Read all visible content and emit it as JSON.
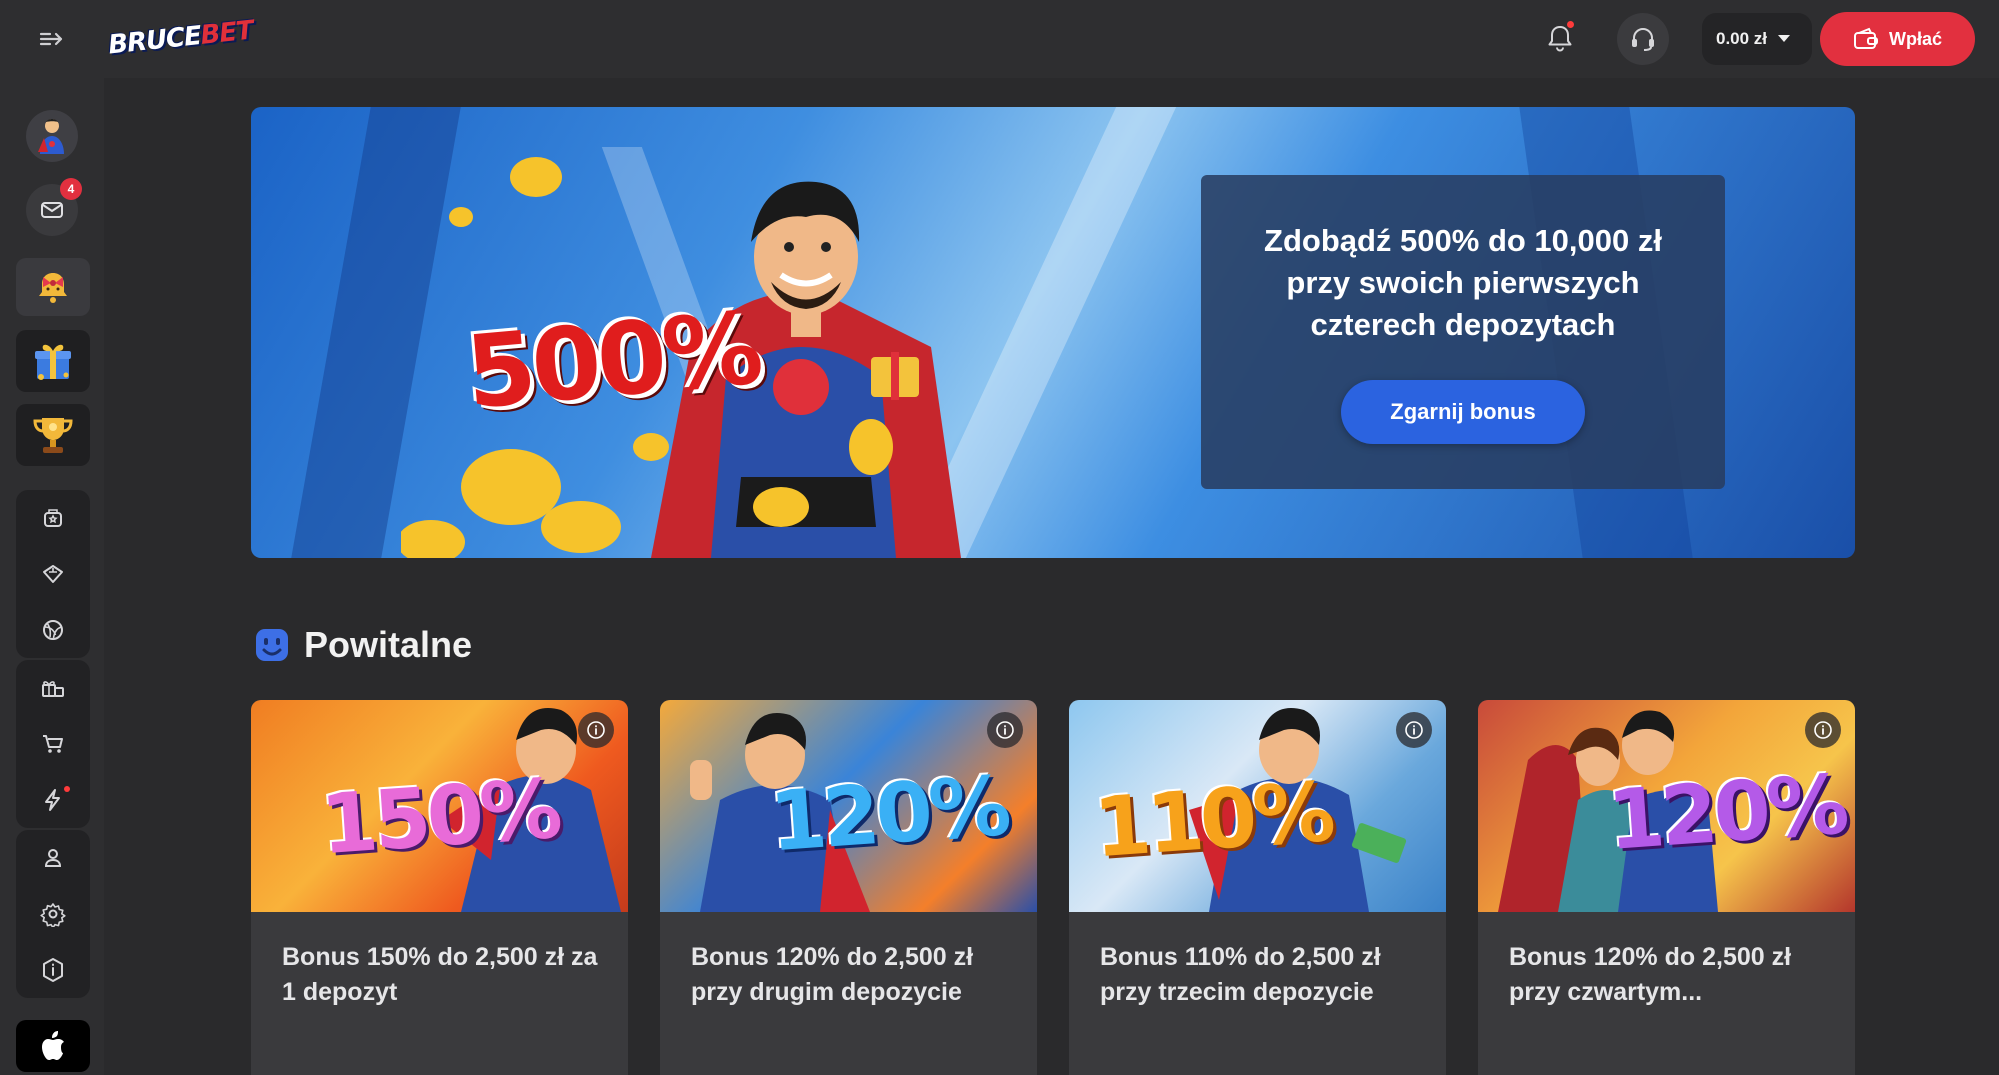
{
  "header": {
    "logo_part1": "BRUCE",
    "logo_part2": "BET",
    "balance": "0.00 zł",
    "deposit_label": "Wpłać",
    "accent": "#e2303f"
  },
  "sidebar": {
    "mail_badge": "4",
    "icons": [
      "avatar",
      "mail-icon",
      "bonus-bell-icon",
      "gift-box-icon",
      "trophy-icon",
      "casino-icon",
      "vip-diamond-icon",
      "sports-ball-icon",
      "gifts-icon",
      "cart-icon",
      "lightning-icon",
      "user-icon",
      "settings-icon",
      "info-hexagon-icon",
      "apple-icon"
    ]
  },
  "hero": {
    "percent": "500%",
    "title": "Zdobądź 500% do 10,000 zł przy swoich pierwszych czterech depozytach",
    "cta": "Zgarnij bonus",
    "cta_color": "#2b63e0"
  },
  "section": {
    "title": "Powitalne"
  },
  "cards": [
    {
      "percent": "150%",
      "text": "Bonus 150% do 2,500 zł za 1 depozyt"
    },
    {
      "percent": "120%",
      "text": "Bonus 120% do 2,500 zł przy drugim depozycie"
    },
    {
      "percent": "110%",
      "text": "Bonus 110% do 2,500 zł przy trzecim depozycie"
    },
    {
      "percent": "120%",
      "text": "Bonus 120% do 2,500 zł przy czwartym..."
    }
  ]
}
